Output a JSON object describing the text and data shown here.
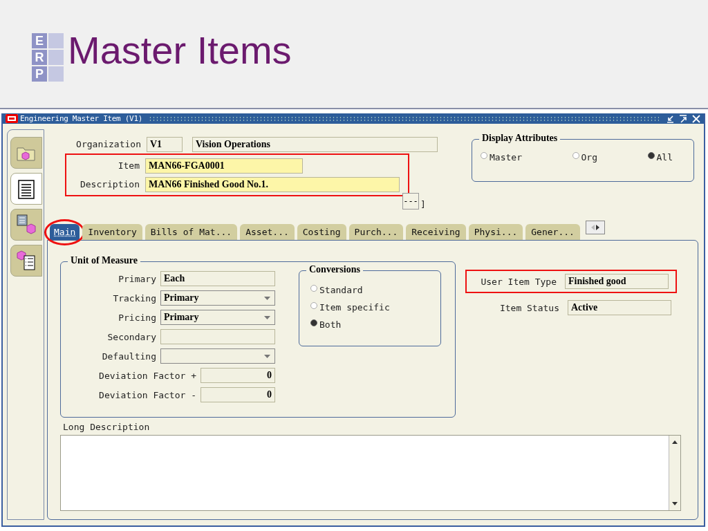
{
  "slide": {
    "logo_letters": [
      "E",
      "R",
      "P"
    ],
    "title": "Master Items"
  },
  "window": {
    "title": "Engineering Master Item (V1)"
  },
  "side_tabs": [
    {
      "kind": "folder",
      "selected": false
    },
    {
      "kind": "list",
      "selected": true
    },
    {
      "kind": "chip",
      "selected": false
    },
    {
      "kind": "cube-list",
      "selected": false
    }
  ],
  "header": {
    "organization": {
      "label": "Organization",
      "code": "V1",
      "name": "Vision Operations"
    },
    "highlighted": true,
    "item": {
      "label": "Item",
      "value": "MAN66-FGA0001"
    },
    "description": {
      "label": "Description",
      "value": "MAN66 Finished Good No.1."
    },
    "flex_button": "---",
    "flex_bracket": "]"
  },
  "display_attributes": {
    "title": "Display Attributes",
    "options": [
      {
        "label": "Master",
        "selected": false
      },
      {
        "label": "Org",
        "selected": false
      },
      {
        "label": "All",
        "selected": true
      }
    ]
  },
  "tabs": [
    {
      "label": "Main",
      "selected": true,
      "circled": true
    },
    {
      "label": "Inventory",
      "selected": false,
      "circled": false
    },
    {
      "label": "Bills of Mat...",
      "selected": false,
      "circled": false
    },
    {
      "label": "Asset...",
      "selected": false,
      "circled": false
    },
    {
      "label": "Costing",
      "selected": false,
      "circled": false
    },
    {
      "label": "Purch...",
      "selected": false,
      "circled": false
    },
    {
      "label": "Receiving",
      "selected": false,
      "circled": false
    },
    {
      "label": "Physi...",
      "selected": false,
      "circled": false
    },
    {
      "label": "Gener...",
      "selected": false,
      "circled": false
    }
  ],
  "unit_of_measure": {
    "title": "Unit of Measure",
    "rows": [
      {
        "label": "Primary",
        "kind": "text",
        "value": "Each"
      },
      {
        "label": "Tracking",
        "kind": "select",
        "value": "Primary"
      },
      {
        "label": "Pricing",
        "kind": "select",
        "value": "Primary"
      },
      {
        "label": "Secondary",
        "kind": "text"
      },
      {
        "label": "Defaulting",
        "kind": "select"
      },
      {
        "label": "Deviation Factor +",
        "kind": "number",
        "value": "0"
      },
      {
        "label": "Deviation Factor -",
        "kind": "number",
        "value": "0"
      }
    ]
  },
  "conversions": {
    "title": "Conversions",
    "options": [
      {
        "label": "Standard",
        "selected": false
      },
      {
        "label": "Item specific",
        "selected": false
      },
      {
        "label": "Both",
        "selected": true
      }
    ]
  },
  "user_item_type": {
    "label": "User Item Type",
    "value": "Finished good",
    "highlighted": true
  },
  "item_status": {
    "label": "Item Status",
    "value": "Active"
  },
  "long_description": {
    "label": "Long Description"
  }
}
